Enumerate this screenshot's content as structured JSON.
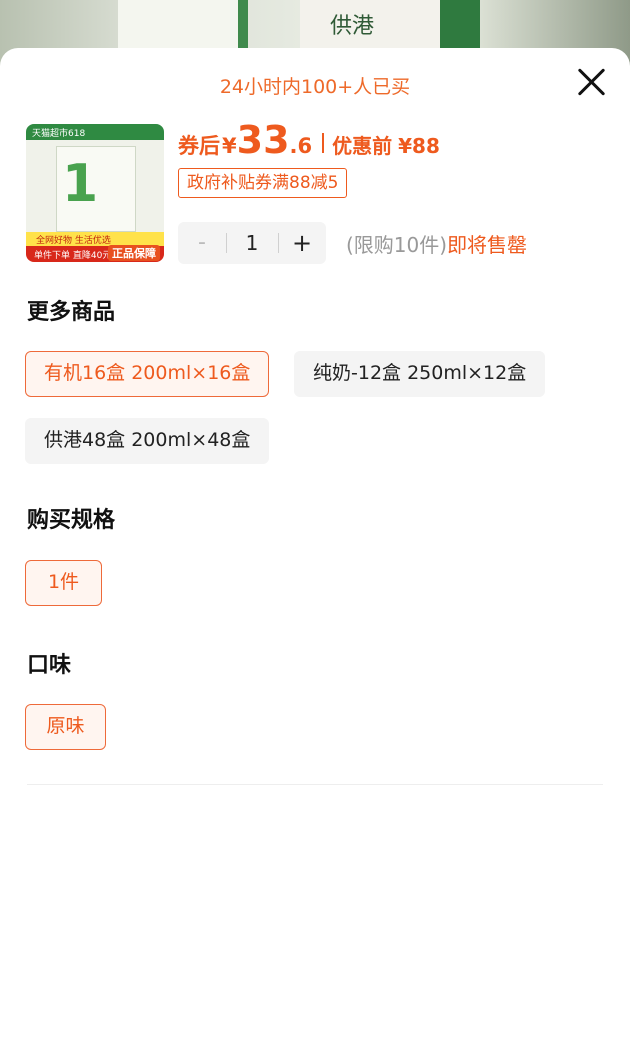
{
  "background": {
    "brand_text": "供港"
  },
  "sheet": {
    "hot_text": "24小时内100+人已买",
    "close_icon": "close-icon"
  },
  "product": {
    "thumb": {
      "top_banner": "天猫超市618",
      "carton_number": "1",
      "yellow_banner": "全网好物 生活优选",
      "bottom_banner": "单件下单 直降40元",
      "badge": "正品保障"
    },
    "price_label": "券后",
    "currency": "¥",
    "price_int": "33",
    "price_dec": ".6",
    "orig_label": "优惠前",
    "orig_price": "¥88",
    "coupon": "政府补贴券满88减5",
    "quantity": {
      "minus": "-",
      "value": "1",
      "plus": "+"
    },
    "limit_text": "(限购10件)",
    "sellout_text": "即将售罄"
  },
  "sections": {
    "more_products": {
      "title": "更多商品",
      "options": [
        {
          "label": "有机16盒 200ml×16盒",
          "selected": true
        },
        {
          "label": "纯奶-12盒 250ml×12盒",
          "selected": false
        },
        {
          "label": "供港48盒 200ml×48盒",
          "selected": false
        }
      ]
    },
    "spec": {
      "title": "购买规格",
      "options": [
        {
          "label": "1件",
          "selected": true
        }
      ]
    },
    "flavor": {
      "title": "口味",
      "options": [
        {
          "label": "原味",
          "selected": true
        }
      ]
    }
  },
  "colors": {
    "accent": "#ee5a1e",
    "selected_bg": "#fff5f0",
    "chip_bg": "#f4f4f4"
  }
}
